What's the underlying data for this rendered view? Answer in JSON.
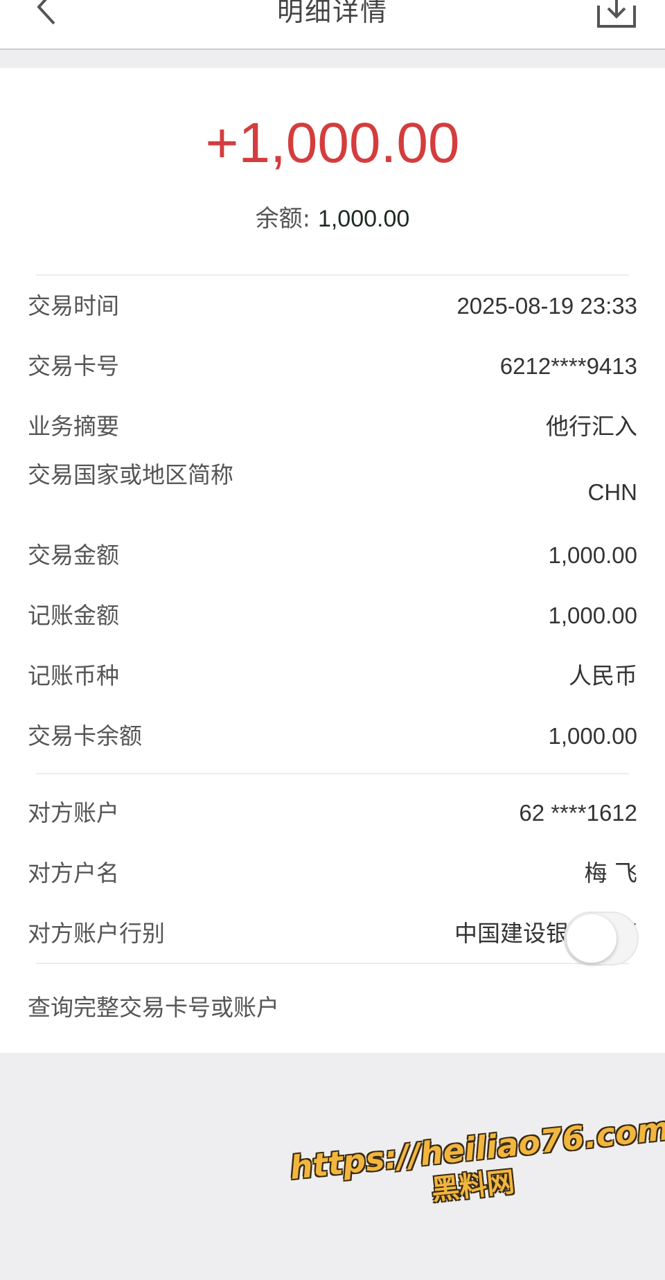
{
  "header": {
    "title": "明细详情",
    "back_icon": "chevron-left-icon",
    "download_icon": "download-icon"
  },
  "summary": {
    "amount": "+1,000.00",
    "balance_label": "余额:",
    "balance_value": "1,000.00",
    "amount_color": "#d43d3d"
  },
  "details": [
    {
      "label": "交易时间",
      "value": "2025-08-19 23:33"
    },
    {
      "label": "交易卡号",
      "value": "6212****9413"
    },
    {
      "label": "业务摘要",
      "value": "他行汇入"
    },
    {
      "label": "交易国家或地区简称",
      "value": "CHN"
    },
    {
      "label": "交易金额",
      "value": "1,000.00"
    },
    {
      "label": "记账金额",
      "value": "1,000.00"
    },
    {
      "label": "记账币种",
      "value": "人民币"
    },
    {
      "label": "交易卡余额",
      "value": "1,000.00"
    }
  ],
  "counterparty": [
    {
      "label": "对方账户",
      "value": "62 ****1612"
    },
    {
      "label": "对方户名",
      "value": "梅 飞"
    },
    {
      "label": "对方账户行别",
      "value": "中国建设银行总行"
    }
  ],
  "toggle": {
    "label": "查询完整交易卡号或账户",
    "state": "off"
  },
  "watermark": {
    "url": "https://heiliao76.com",
    "name": "黑料网"
  }
}
